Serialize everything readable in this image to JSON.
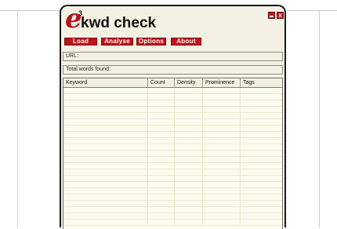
{
  "app": {
    "logo_letter": "e",
    "logo_superscript": "3",
    "title": "kwd check"
  },
  "window_controls": {
    "close_glyph": "x"
  },
  "menu": {
    "items": [
      "Load",
      "Analyse",
      "Options",
      "About"
    ]
  },
  "fields": {
    "url_label": "URL:",
    "total_label": "Total words found:"
  },
  "table": {
    "columns": [
      "Keyword",
      "Count",
      "Density",
      "Prominence",
      "Tags"
    ],
    "rows": []
  },
  "colors": {
    "accent": "#c3111a",
    "window_bg": "#f4f1e4",
    "table_bg": "#fbfbef"
  }
}
